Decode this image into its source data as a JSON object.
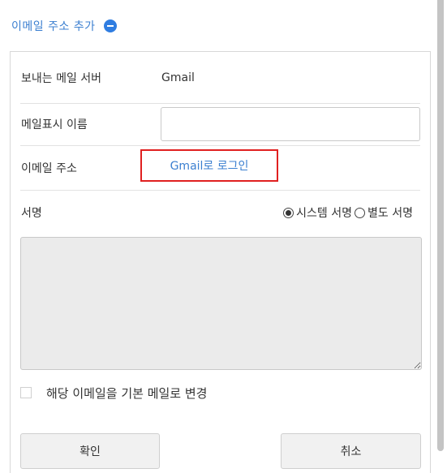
{
  "header": {
    "title": "이메일 주소 추가",
    "collapse_icon": "minus-circle-icon",
    "accent_color": "#2f7de1"
  },
  "form": {
    "mail_server": {
      "label": "보내는 메일 서버",
      "value": "Gmail"
    },
    "display_name": {
      "label": "메일표시 이름",
      "value": ""
    },
    "email_address": {
      "label": "이메일 주소",
      "login_link": "Gmail로 로그인",
      "highlight_color": "#e02020"
    },
    "signature": {
      "label": "서명",
      "options": [
        "시스템 서명",
        "별도 서명"
      ],
      "selected": "시스템 서명",
      "content": ""
    },
    "set_default": {
      "label": "해당 이메일을 기본 메일로 변경",
      "checked": false
    }
  },
  "buttons": {
    "confirm": "확인",
    "cancel": "취소"
  }
}
